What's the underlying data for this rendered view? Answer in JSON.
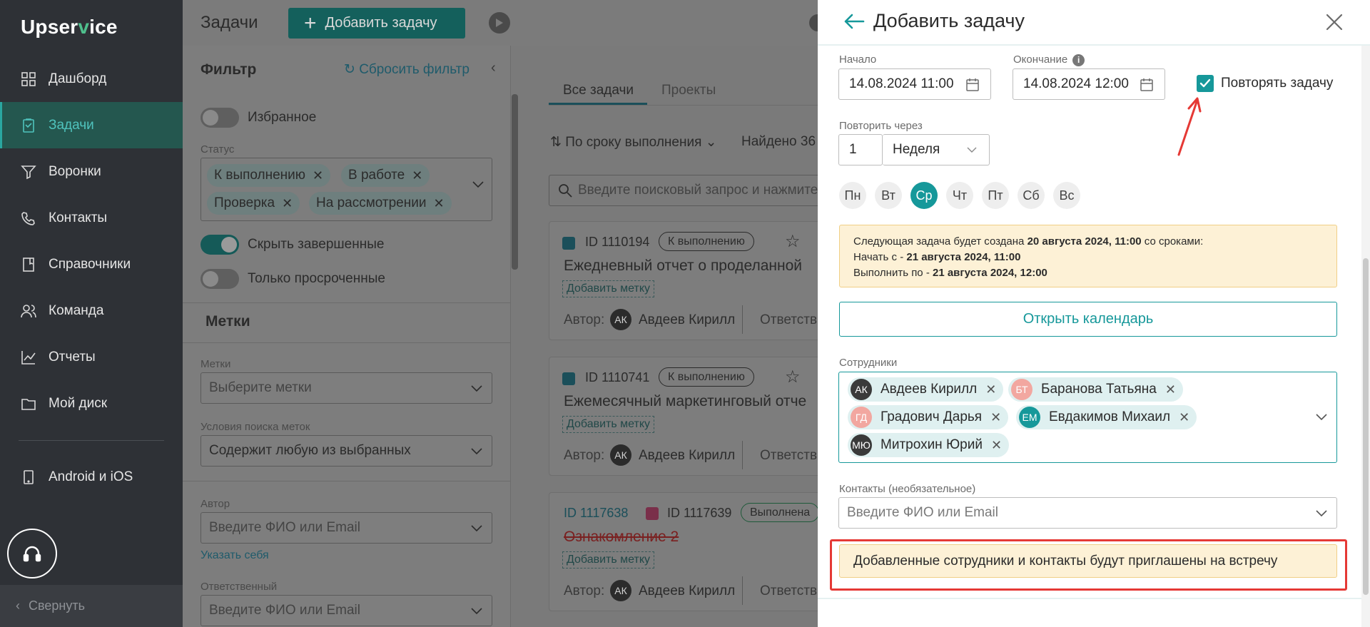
{
  "app": {
    "logo_left": "Upser",
    "logo_mark": "v",
    "logo_right": "ice"
  },
  "sidebar": {
    "items": [
      {
        "label": "Дашборд",
        "icon": "dashboard-icon"
      },
      {
        "label": "Задачи",
        "icon": "tasks-icon",
        "active": true
      },
      {
        "label": "Воронки",
        "icon": "funnel-icon"
      },
      {
        "label": "Контакты",
        "icon": "contacts-icon"
      },
      {
        "label": "Справочники",
        "icon": "book-icon"
      },
      {
        "label": "Команда",
        "icon": "team-icon"
      },
      {
        "label": "Отчеты",
        "icon": "reports-icon"
      },
      {
        "label": "Мой диск",
        "icon": "folder-icon"
      },
      {
        "label": "Android и iOS",
        "icon": "phone-icon"
      }
    ],
    "collapse_label": "Свернуть"
  },
  "header": {
    "title": "Задачи",
    "add_button": "Добавить задачу"
  },
  "filter": {
    "title": "Фильтр",
    "reset": "Сбросить фильтр",
    "favorites": "Избранное",
    "status_label": "Статус",
    "status_chips": [
      "К выполнению",
      "В работе",
      "Проверка",
      "На рассмотрении"
    ],
    "hide_completed": "Скрыть завершенные",
    "only_overdue": "Только просроченные",
    "tags_section": "Метки",
    "tags_label": "Метки",
    "tags_placeholder": "Выберите метки",
    "tag_condition_label": "Условия поиска меток",
    "tag_condition_value": "Содержит любую из выбранных",
    "author_label": "Автор",
    "author_placeholder": "Введите ФИО или Email",
    "author_self": "Указать себя",
    "responsible_label": "Ответственный",
    "responsible_placeholder": "Введите ФИО или Email"
  },
  "tasks": {
    "tabs": [
      "Все задачи",
      "Проекты"
    ],
    "sort": "По сроку выполнения",
    "found": "Найдено 36",
    "search_placeholder": "Введите поисковый запрос и нажмите",
    "author_prefix": "Автор:",
    "responsible_prefix": "Ответств",
    "add_tag": "Добавить метку",
    "cards": [
      {
        "id": "ID 1110194",
        "status": "К выполнению",
        "title": "Ежедневный отчет о проделанной",
        "author": "Авдеев Кирилл",
        "initials": "АК"
      },
      {
        "id": "ID 1110741",
        "status": "К выполнению",
        "title": "Ежемесячный маркетинговый отче",
        "author": "Авдеев Кирилл",
        "initials": "АК"
      },
      {
        "id_parent": "ID 1117638",
        "id": "ID 1117639",
        "status": "Выполнена",
        "title": "Ознакомление 2",
        "author": "Авдеев Кирилл",
        "initials": "АК"
      }
    ]
  },
  "drawer": {
    "title": "Добавить задачу",
    "start_label": "Начало",
    "start_value": "14.08.2024 11:00",
    "end_label": "Окончание",
    "end_value": "14.08.2024 12:00",
    "repeat_checkbox": "Повторять задачу",
    "repeat_every_label": "Повторить через",
    "repeat_count": "1",
    "repeat_unit": "Неделя",
    "days": [
      "Пн",
      "Вт",
      "Ср",
      "Чт",
      "Пт",
      "Сб",
      "Вс"
    ],
    "selected_day": "Ср",
    "info_line1_prefix": "Следующая задача будет создана ",
    "info_line1_bold": "20 августа 2024, 11:00",
    "info_line1_suffix": " со сроками:",
    "info_line2_prefix": "Начать с - ",
    "info_line2_bold": "21 августа 2024, 11:00",
    "info_line3_prefix": "Выполнить по - ",
    "info_line3_bold": "21 августа 2024, 12:00",
    "open_calendar": "Открыть календарь",
    "employees_label": "Сотрудники",
    "employees": [
      {
        "name": "Авдеев Кирилл",
        "initials": "АК",
        "color": "#3a3a3a"
      },
      {
        "name": "Баранова Татьяна",
        "initials": "БТ",
        "color": "#f2a7a0"
      },
      {
        "name": "Градович Дарья",
        "initials": "ГД",
        "color": "#f2a7a0"
      },
      {
        "name": "Евдакимов Михаил",
        "initials": "ЕМ",
        "color": "#16989a"
      },
      {
        "name": "Митрохин Юрий",
        "initials": "МЮ",
        "color": "#3a3a3a"
      }
    ],
    "contacts_label": "Контакты (необязательное)",
    "contacts_placeholder": "Введите ФИО или Email",
    "invite_notice": "Добавленные сотрудники и контакты будут приглашены на встречу"
  },
  "colors": {
    "accent": "#16989a",
    "sidebar_bg": "#2e3136",
    "highlight": "#e53935",
    "note_bg": "#fdf1d6"
  }
}
